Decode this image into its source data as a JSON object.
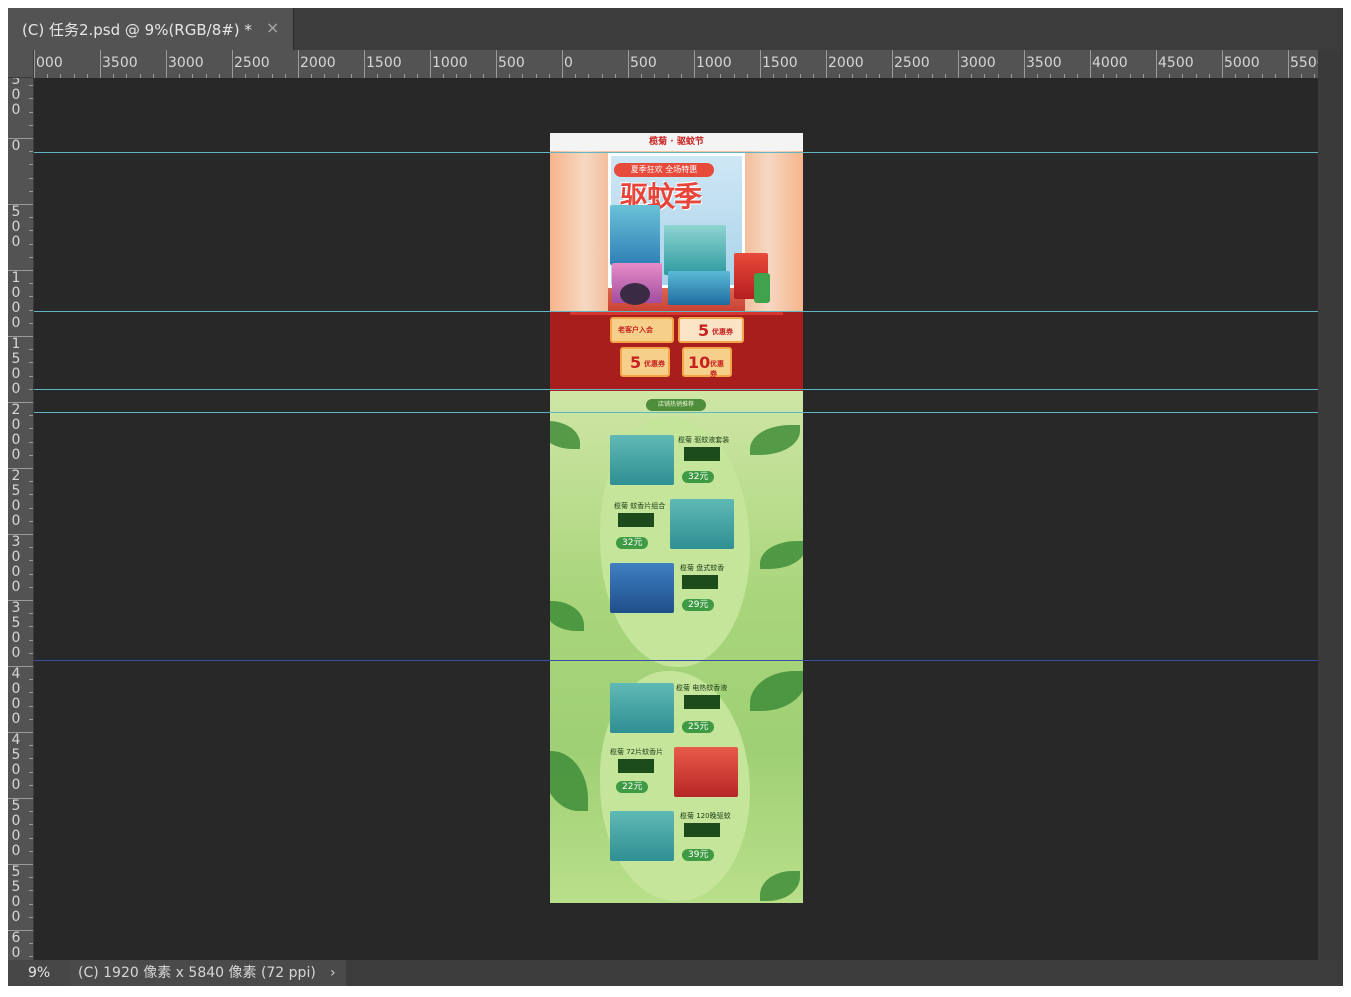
{
  "document_tab": {
    "title": "(C) 任务2.psd @ 9%(RGB/8#) *",
    "close_glyph": "×",
    "icon": "close-icon"
  },
  "ruler_horizontal": {
    "labels": [
      "000",
      "3500",
      "3000",
      "2500",
      "2000",
      "1500",
      "1000",
      "500",
      "0",
      "500",
      "1000",
      "1500",
      "2000",
      "2500",
      "3000",
      "3500",
      "4000",
      "4500",
      "5000",
      "5500"
    ]
  },
  "ruler_vertical": {
    "labels": [
      "500",
      "0",
      "500",
      "1000",
      "1500",
      "2000",
      "2500",
      "3000",
      "3500",
      "4000",
      "4500",
      "5000",
      "5500",
      "60"
    ]
  },
  "guides": {
    "colors": {
      "normal": "#5fb7c4",
      "selected": "#3a4ea8"
    },
    "count": 5
  },
  "artboard": {
    "header_text": "榄菊 · 驱蚊节",
    "promo_tag": "夏季狂欢 全场特惠",
    "title": "驱蚊季",
    "coupons": [
      {
        "amount": "5",
        "label": "优惠券"
      },
      {
        "amount": "5",
        "label": "优惠券"
      },
      {
        "amount": "10",
        "label": "优惠券"
      }
    ],
    "coupon_member": "老客户入会",
    "section_label": "店铺热销推荐",
    "products": [
      {
        "title": "榄菊 驱蚊液套装",
        "price": "32元"
      },
      {
        "title": "榄菊 蚊香片组合",
        "price": "32元"
      },
      {
        "title": "榄菊 盘式蚊香",
        "price": "29元"
      },
      {
        "title": "榄菊 电热蚊香液",
        "price": "25元"
      },
      {
        "title": "榄菊 72片蚊香片",
        "price": "22元"
      },
      {
        "title": "榄菊 120晚驱蚊",
        "price": "39元"
      }
    ]
  },
  "status_bar": {
    "zoom": "9%",
    "doc_info": "(C) 1920 像素 x 5840 像素 (72 ppi)",
    "arrow": "›"
  }
}
